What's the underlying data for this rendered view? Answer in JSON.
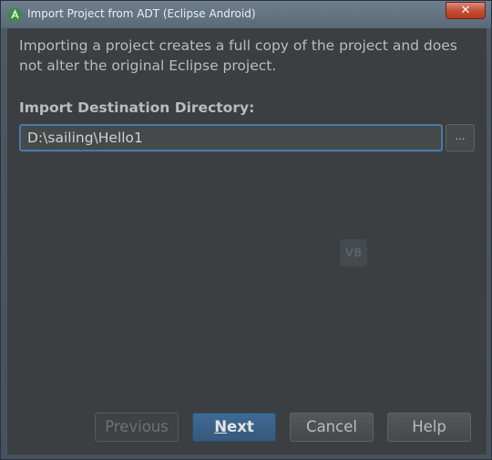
{
  "window": {
    "title": "Import Project from ADT (Eclipse Android)",
    "close_glyph": "✕"
  },
  "content": {
    "description": "Importing a project creates a full copy of the project and does not alter the original Eclipse project.",
    "destination_label": "Import Destination Directory:",
    "destination_value": "D:\\sailing\\Hello1",
    "browse_label": "...",
    "watermark_text": "VB"
  },
  "buttons": {
    "previous": "Previous",
    "next_mnemonic": "N",
    "next_rest": "ext",
    "cancel": "Cancel",
    "help": "Help"
  },
  "icons": {
    "app": "android-studio-icon",
    "close": "close-icon",
    "watermark": "watermark-icon"
  },
  "colors": {
    "primary_button": "#3f6a93",
    "focus_border": "#4a7aa8",
    "panel_bg": "#3c3f41"
  }
}
